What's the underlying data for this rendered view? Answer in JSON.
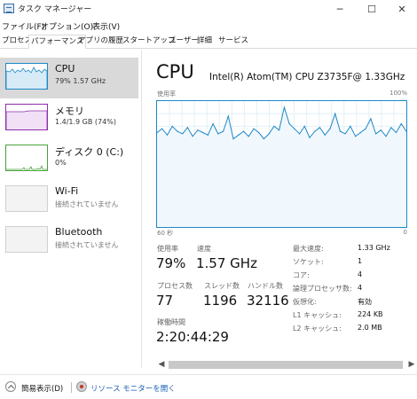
{
  "window": {
    "title": "タスク マネージャー",
    "minimize_glyph": "─",
    "maximize_glyph": "☐",
    "close_glyph": "✕"
  },
  "menu": [
    "ファイル(F)",
    "オプション(O)",
    "表示(V)"
  ],
  "tabs": [
    "プロセス",
    "パフォーマンス",
    "アプリの履歴",
    "スタートアップ",
    "ユーザー",
    "詳細",
    "サービス"
  ],
  "active_tab": "パフォーマンス",
  "sidebar": {
    "items": [
      {
        "title": "CPU",
        "subtitle": "79%  1.57 GHz",
        "color": "#1e88c7"
      },
      {
        "title": "メモリ",
        "subtitle": "1.4/1.9 GB (74%)",
        "color": "#8b2fa8"
      },
      {
        "title": "ディスク 0 (C:)",
        "subtitle": "0%",
        "color": "#4aa23c"
      },
      {
        "title": "Wi-Fi",
        "subtitle": "接続されていません",
        "color": "#bbbbbb"
      },
      {
        "title": "Bluetooth",
        "subtitle": "接続されていません",
        "color": "#bbbbbb"
      }
    ]
  },
  "main": {
    "heading": "CPU",
    "model": "Intel(R) Atom(TM) CPU Z3735F@ 1.33GHz",
    "graph_label": "使用率",
    "graph_max": "100%",
    "graph_time": "60 秒",
    "graph_min": "0",
    "utilization_label": "使用率",
    "utilization": "79%",
    "speed_label": "速度",
    "speed": "1.57 GHz",
    "processes_label": "プロセス数",
    "processes": "77",
    "threads_label": "スレッド数",
    "threads": "1196",
    "handles_label": "ハンドル数",
    "handles": "32116",
    "uptime_label": "稼働時間",
    "uptime": "2:20:44:29",
    "details": [
      {
        "label": "最大速度:",
        "value": "1.33 GHz"
      },
      {
        "label": "ソケット:",
        "value": "1"
      },
      {
        "label": "コア:",
        "value": "4"
      },
      {
        "label": "論理プロセッサ数:",
        "value": "4"
      },
      {
        "label": "仮想化:",
        "value": "有効"
      },
      {
        "label": "L1 キャッシュ:",
        "value": "224 KB"
      },
      {
        "label": "L2 キャッシュ:",
        "value": "2.0 MB"
      }
    ]
  },
  "footer": {
    "fewer_details": "簡易表示(D)",
    "resource_monitor": "リソース モニターを開く"
  },
  "chart_data": {
    "type": "area",
    "ylim": [
      0,
      100
    ],
    "x_range_seconds": 60,
    "values": [
      75,
      78,
      73,
      80,
      76,
      74,
      79,
      72,
      77,
      75,
      73,
      82,
      74,
      76,
      88,
      70,
      73,
      76,
      72,
      78,
      75,
      70,
      74,
      80,
      77,
      95,
      82,
      78,
      74,
      80,
      71,
      76,
      79,
      73,
      78,
      90,
      76,
      74,
      80,
      72,
      75,
      78,
      86,
      74,
      77,
      72,
      79,
      75,
      82,
      76
    ]
  }
}
